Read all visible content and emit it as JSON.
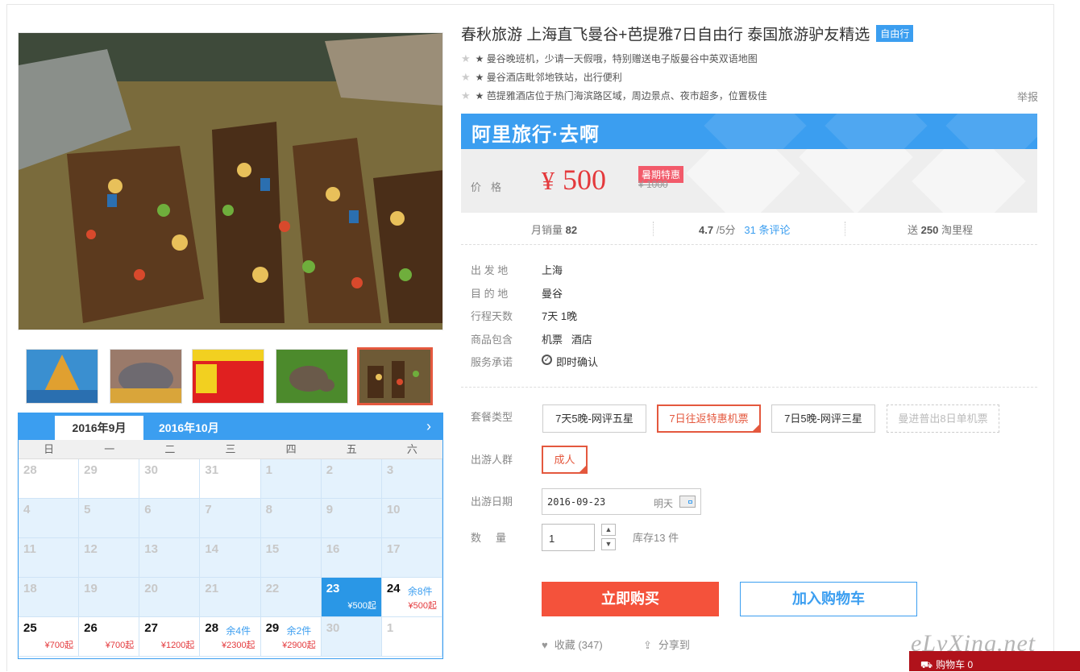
{
  "product": {
    "title": "春秋旅游 上海直飞曼谷+芭提雅7日自由行 泰国旅游驴友精选",
    "tag": "自由行",
    "highlights": [
      "★ 曼谷晚班机，少请一天假哦，特别赠送电子版曼谷中英双语地图",
      "★ 曼谷酒店毗邻地铁站，出行便利",
      "★ 芭提雅酒店位于热门海滨路区域，周边景点、夜市超多，位置极佳"
    ],
    "report": "举报"
  },
  "brand": {
    "logo": "阿里旅行·去啊"
  },
  "price": {
    "label": "价格",
    "currency": "¥",
    "value": "500",
    "badge": "暑期特惠",
    "original": "¥ 1000"
  },
  "stats": {
    "sales_label": "月销量",
    "sales": "82",
    "rating": "4.7",
    "rating_suffix": "/5分",
    "reviews": "31 条评论",
    "points_prefix": "送",
    "points": "250",
    "points_suffix": "淘里程"
  },
  "details": [
    {
      "key": "出 发 地",
      "value": "上海"
    },
    {
      "key": "目 的 地",
      "value": "曼谷"
    },
    {
      "key": "行程天数",
      "value": "7天 1晚"
    },
    {
      "key": "商品包含",
      "value": "机票   酒店"
    },
    {
      "key": "服务承诺",
      "value": "即时确认"
    }
  ],
  "package": {
    "label": "套餐类型",
    "options": [
      "7天5晚-网评五星",
      "7日往返特惠机票",
      "7日5晚-网评三星",
      "曼进普出8日单机票"
    ]
  },
  "traveler": {
    "label": "出游人群",
    "option": "成人"
  },
  "date": {
    "label": "出游日期",
    "value": "2016-09-23",
    "hint": "明天"
  },
  "quantity": {
    "label": "数     量",
    "value": "1",
    "stock": "库存13 件"
  },
  "actions": {
    "buy": "立即购买",
    "cart": "加入购物车",
    "fav": "收藏 (347)",
    "share": "分享到"
  },
  "calendar": {
    "tabs": [
      "2016年9月",
      "2016年10月"
    ],
    "weekdays": [
      "日",
      "一",
      "二",
      "三",
      "四",
      "五",
      "六"
    ],
    "days": [
      {
        "n": "28",
        "t": "out"
      },
      {
        "n": "29",
        "t": "out"
      },
      {
        "n": "30",
        "t": "out"
      },
      {
        "n": "31",
        "t": "out"
      },
      {
        "n": "1",
        "t": "in"
      },
      {
        "n": "2",
        "t": "in"
      },
      {
        "n": "3",
        "t": "in"
      },
      {
        "n": "4",
        "t": "in"
      },
      {
        "n": "5",
        "t": "in"
      },
      {
        "n": "6",
        "t": "in"
      },
      {
        "n": "7",
        "t": "in"
      },
      {
        "n": "8",
        "t": "in"
      },
      {
        "n": "9",
        "t": "in"
      },
      {
        "n": "10",
        "t": "in"
      },
      {
        "n": "11",
        "t": "in"
      },
      {
        "n": "12",
        "t": "in"
      },
      {
        "n": "13",
        "t": "in"
      },
      {
        "n": "14",
        "t": "in"
      },
      {
        "n": "15",
        "t": "in"
      },
      {
        "n": "16",
        "t": "in"
      },
      {
        "n": "17",
        "t": "in"
      },
      {
        "n": "18",
        "t": "in"
      },
      {
        "n": "19",
        "t": "in"
      },
      {
        "n": "20",
        "t": "in"
      },
      {
        "n": "21",
        "t": "in"
      },
      {
        "n": "22",
        "t": "in"
      },
      {
        "n": "23",
        "t": "sel",
        "p": "¥500起"
      },
      {
        "n": "24",
        "t": "avail",
        "rem": "余8件",
        "p": "¥500起"
      },
      {
        "n": "25",
        "t": "avail",
        "p": "¥700起"
      },
      {
        "n": "26",
        "t": "avail",
        "p": "¥700起"
      },
      {
        "n": "27",
        "t": "avail",
        "p": "¥1200起"
      },
      {
        "n": "28",
        "t": "avail",
        "rem": "余4件",
        "p": "¥2300起"
      },
      {
        "n": "29",
        "t": "avail",
        "rem": "余2件",
        "p": "¥2900起"
      },
      {
        "n": "30",
        "t": "in"
      },
      {
        "n": "1",
        "t": "out"
      }
    ]
  },
  "watermark": "eLvXing.net",
  "minicart": "购物车 0",
  "colors": {
    "accent": "#3b9ef0",
    "price": "#e4393c",
    "buy": "#f4523b",
    "selected": "#e4583e"
  }
}
